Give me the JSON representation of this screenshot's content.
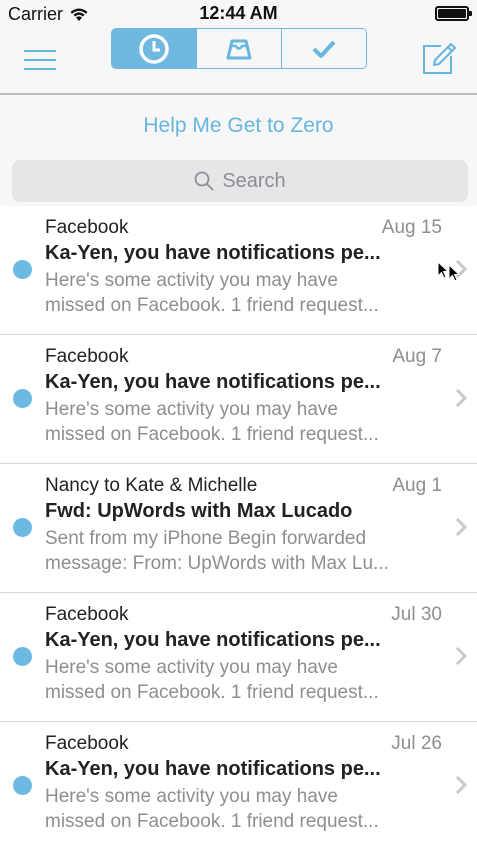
{
  "status_bar": {
    "carrier": "Carrier",
    "time": "12:44 AM"
  },
  "nav": {
    "menu_icon": "hamburger-icon",
    "segments": [
      {
        "icon": "clock-icon",
        "active": true
      },
      {
        "icon": "inbox-tray-icon",
        "active": false
      },
      {
        "icon": "checkmark-icon",
        "active": false
      }
    ],
    "compose_icon": "compose-icon"
  },
  "help_link": "Help Me Get to Zero",
  "search": {
    "placeholder": "Search"
  },
  "colors": {
    "accent": "#6fb8e0",
    "unread_dot": "#6cb9e3",
    "secondary_text": "#8e8e93"
  },
  "messages": [
    {
      "sender": "Facebook",
      "date": "Aug 15",
      "subject": "Ka-Yen, you have notifications pe...",
      "preview_line1": "Here's some activity you may have",
      "preview_line2": "missed on Facebook. 1 friend request...",
      "unread": true
    },
    {
      "sender": "Facebook",
      "date": "Aug 7",
      "subject": "Ka-Yen, you have notifications pe...",
      "preview_line1": "Here's some activity you may have",
      "preview_line2": "missed on Facebook. 1 friend request...",
      "unread": true
    },
    {
      "sender": "Nancy to Kate & Michelle",
      "date": "Aug 1",
      "subject": "Fwd: UpWords with Max Lucado",
      "preview_line1": "Sent from my iPhone Begin forwarded",
      "preview_line2": "message: From: UpWords with Max Lu...",
      "unread": true
    },
    {
      "sender": "Facebook",
      "date": "Jul 30",
      "subject": "Ka-Yen, you have notifications pe...",
      "preview_line1": "Here's some activity you may have",
      "preview_line2": "missed on Facebook. 1 friend request...",
      "unread": true
    },
    {
      "sender": "Facebook",
      "date": "Jul 26",
      "subject": "Ka-Yen, you have notifications pe...",
      "preview_line1": "Here's some activity you may have",
      "preview_line2": "missed on Facebook. 1 friend request...",
      "unread": true
    }
  ]
}
